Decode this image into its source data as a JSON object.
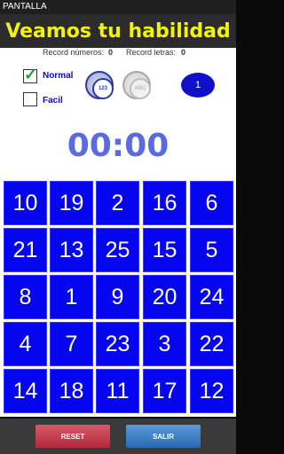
{
  "window": {
    "title": "PANTALLA"
  },
  "header": {
    "title": "Veamos tu habilidad"
  },
  "records": {
    "numbers_label": "Record números:",
    "numbers_value": "0",
    "letters_label": "Record letras:",
    "letters_value": "0"
  },
  "options": {
    "normal_label": "Normal",
    "normal_checked": true,
    "facil_label": "Facil",
    "facil_checked": false
  },
  "mode_icons": {
    "numbers_text": "123",
    "letters_text": "ABC"
  },
  "level": "1",
  "timer": "00:00",
  "grid": [
    [
      "10",
      "19",
      "2",
      "16",
      "6"
    ],
    [
      "21",
      "13",
      "25",
      "15",
      "5"
    ],
    [
      "8",
      "1",
      "9",
      "20",
      "24"
    ],
    [
      "4",
      "7",
      "23",
      "3",
      "22"
    ],
    [
      "14",
      "18",
      "11",
      "17",
      "12"
    ]
  ],
  "footer": {
    "reset_label": "RESET",
    "salir_label": "SALIR"
  },
  "colors": {
    "cell": "#0505f0",
    "title": "#f2f20a",
    "timer": "#5a6ae0"
  }
}
